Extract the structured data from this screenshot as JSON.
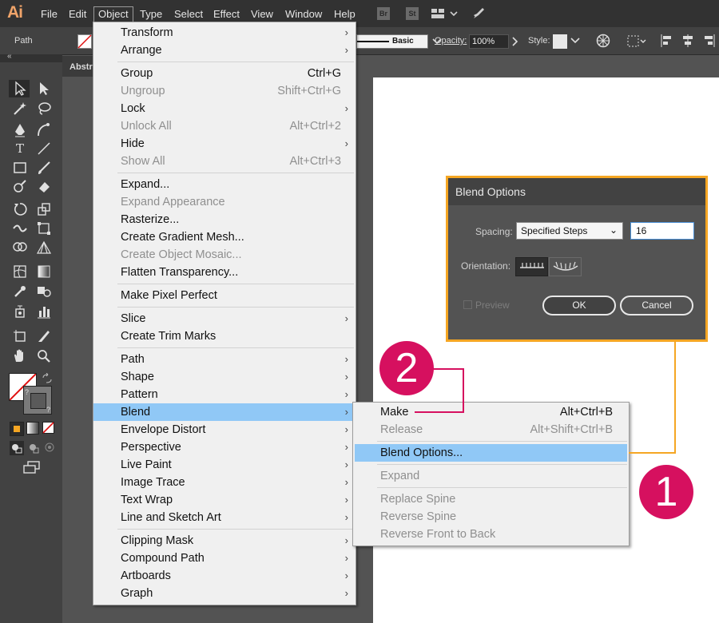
{
  "app": {
    "logo": "Ai"
  },
  "menubar": {
    "items": [
      "File",
      "Edit",
      "Object",
      "Type",
      "Select",
      "Effect",
      "View",
      "Window",
      "Help"
    ],
    "icons": {
      "bridge": "Br",
      "stock": "St"
    }
  },
  "controlbar": {
    "selection_label": "Path",
    "stroke_profile": "Basic",
    "opacity_label": "Opacity:",
    "opacity_value": "100%",
    "style_label": "Style:"
  },
  "document": {
    "tab_label": "Abstr"
  },
  "object_menu": {
    "items": [
      {
        "label": "Transform",
        "submenu": true
      },
      {
        "label": "Arrange",
        "submenu": true
      },
      {
        "label": "Group",
        "shortcut": "Ctrl+G"
      },
      {
        "label": "Ungroup",
        "shortcut": "Shift+Ctrl+G",
        "disabled": true
      },
      {
        "label": "Lock",
        "submenu": true
      },
      {
        "label": "Unlock All",
        "shortcut": "Alt+Ctrl+2",
        "disabled": true
      },
      {
        "label": "Hide",
        "submenu": true
      },
      {
        "label": "Show All",
        "shortcut": "Alt+Ctrl+3",
        "disabled": true
      },
      {
        "label": "Expand..."
      },
      {
        "label": "Expand Appearance",
        "disabled": true
      },
      {
        "label": "Rasterize..."
      },
      {
        "label": "Create Gradient Mesh..."
      },
      {
        "label": "Create Object Mosaic...",
        "disabled": true
      },
      {
        "label": "Flatten Transparency..."
      },
      {
        "label": "Make Pixel Perfect"
      },
      {
        "label": "Slice",
        "submenu": true
      },
      {
        "label": "Create Trim Marks"
      },
      {
        "label": "Path",
        "submenu": true
      },
      {
        "label": "Shape",
        "submenu": true
      },
      {
        "label": "Pattern",
        "submenu": true
      },
      {
        "label": "Blend",
        "submenu": true,
        "selected": true
      },
      {
        "label": "Envelope Distort",
        "submenu": true
      },
      {
        "label": "Perspective",
        "submenu": true
      },
      {
        "label": "Live Paint",
        "submenu": true
      },
      {
        "label": "Image Trace",
        "submenu": true
      },
      {
        "label": "Text Wrap",
        "submenu": true
      },
      {
        "label": "Line and Sketch Art",
        "submenu": true
      },
      {
        "label": "Clipping Mask",
        "submenu": true
      },
      {
        "label": "Compound Path",
        "submenu": true
      },
      {
        "label": "Artboards",
        "submenu": true
      },
      {
        "label": "Graph",
        "submenu": true
      }
    ]
  },
  "blend_menu": {
    "items": [
      {
        "label": "Make",
        "shortcut": "Alt+Ctrl+B"
      },
      {
        "label": "Release",
        "shortcut": "Alt+Shift+Ctrl+B",
        "disabled": true
      },
      {
        "label": "Blend Options...",
        "selected": true
      },
      {
        "label": "Expand",
        "disabled": true
      },
      {
        "label": "Replace Spine",
        "disabled": true
      },
      {
        "label": "Reverse Spine",
        "disabled": true
      },
      {
        "label": "Reverse Front to Back",
        "disabled": true
      }
    ]
  },
  "dialog": {
    "title": "Blend Options",
    "spacing_label": "Spacing:",
    "spacing_value": "Specified Steps",
    "steps_value": "16",
    "orientation_label": "Orientation:",
    "preview_label": "Preview",
    "ok_label": "OK",
    "cancel_label": "Cancel"
  },
  "callouts": {
    "one": "1",
    "two": "2"
  },
  "colors": {
    "accent_pink": "#d6105f",
    "highlight_orange": "#f5a623",
    "menu_selection": "#90c8f6"
  }
}
